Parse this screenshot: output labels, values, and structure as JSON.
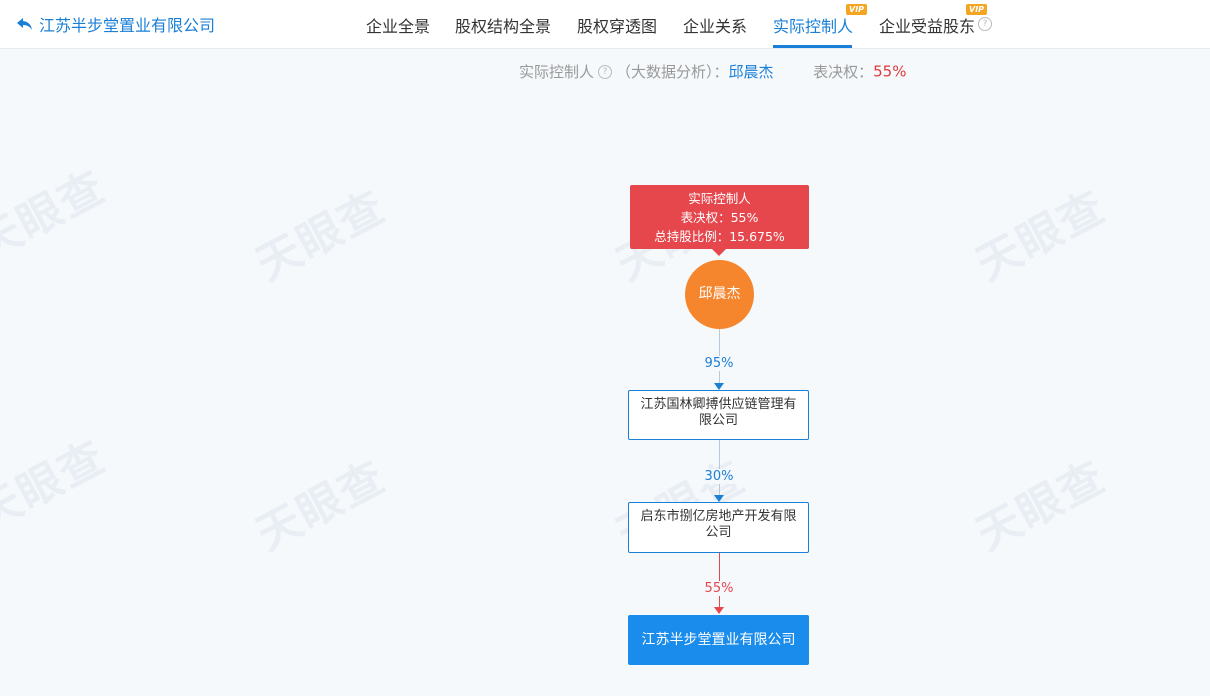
{
  "header": {
    "company_title": "江苏半步堂置业有限公司",
    "tabs": [
      {
        "label": "企业全景"
      },
      {
        "label": "股权结构全景"
      },
      {
        "label": "股权穿透图"
      },
      {
        "label": "企业关系"
      },
      {
        "label": "实际控制人",
        "badge": "VIP",
        "active": true
      },
      {
        "label": "企业受益股东",
        "badge": "VIP"
      }
    ]
  },
  "summary": {
    "label": "实际控制人",
    "help": "?",
    "method": "（大数据分析）：",
    "controller": "邱晨杰",
    "vote_label": "表决权：",
    "vote_value": "55%"
  },
  "watermark": "天眼查",
  "graph": {
    "controller_card": {
      "line1": "实际控制人",
      "line2": "表决权：55%",
      "line3": "总持股比例：15.675%"
    },
    "person": "邱晨杰",
    "edges": [
      "95%",
      "30%",
      "55%"
    ],
    "company1": "江苏国林卿搏供应链管理有限公司",
    "company2": "启东市捌亿房地产开发有限公司",
    "target": "江苏半步堂置业有限公司"
  },
  "colors": {
    "accent": "#1a7fd6",
    "controller_red": "#e5474d",
    "person_orange": "#f5862e",
    "target_blue": "#1a8cec",
    "vip_orange": "#f4a623"
  }
}
